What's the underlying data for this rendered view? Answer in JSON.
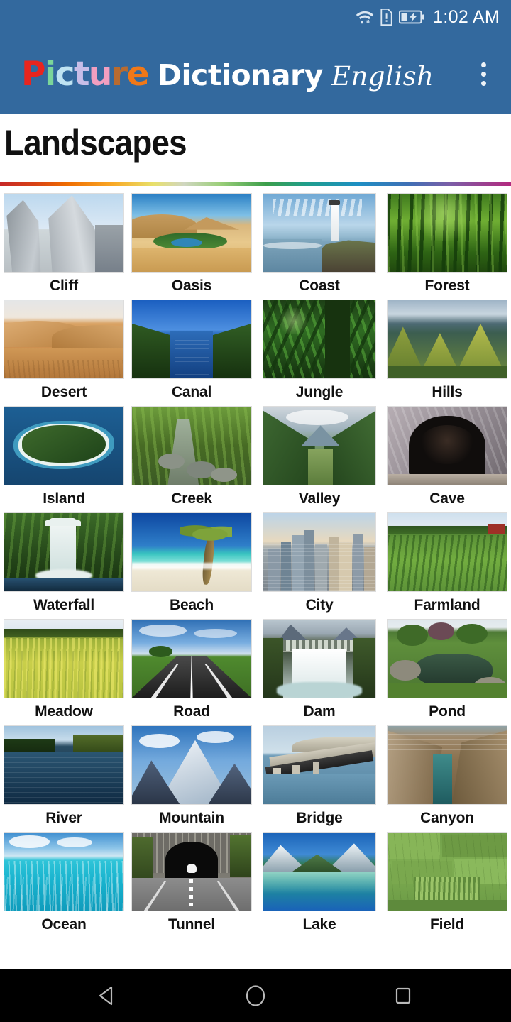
{
  "status_bar": {
    "time": "1:02 AM",
    "icons": [
      "wifi-icon",
      "sim-alert-icon",
      "battery-charging-icon"
    ]
  },
  "app_bar": {
    "background_color": "#33699E",
    "logo": {
      "word1": "Picture",
      "word1_letters": [
        {
          "char": "P",
          "color": "#E8251F"
        },
        {
          "char": "i",
          "color": "#7BD69A"
        },
        {
          "char": "c",
          "color": "#BFE3F2"
        },
        {
          "char": "t",
          "color": "#C8BEE8"
        },
        {
          "char": "u",
          "color": "#F29FC0"
        },
        {
          "char": "r",
          "color": "#B86B30"
        },
        {
          "char": "e",
          "color": "#F07818"
        }
      ],
      "word2": "Dictionary",
      "word3": "English"
    },
    "overflow_menu": "more-options"
  },
  "page": {
    "title": "Landscapes",
    "divider": "rainbow-rule"
  },
  "grid": {
    "columns": 4,
    "items": [
      {
        "label": "Cliff",
        "scene": "cliff"
      },
      {
        "label": "Oasis",
        "scene": "oasis"
      },
      {
        "label": "Coast",
        "scene": "coast"
      },
      {
        "label": "Forest",
        "scene": "forest"
      },
      {
        "label": "Desert",
        "scene": "desert"
      },
      {
        "label": "Canal",
        "scene": "canal"
      },
      {
        "label": "Jungle",
        "scene": "jungle"
      },
      {
        "label": "Hills",
        "scene": "hills"
      },
      {
        "label": "Island",
        "scene": "island"
      },
      {
        "label": "Creek",
        "scene": "creek"
      },
      {
        "label": "Valley",
        "scene": "valley"
      },
      {
        "label": "Cave",
        "scene": "cave"
      },
      {
        "label": "Waterfall",
        "scene": "waterfall"
      },
      {
        "label": "Beach",
        "scene": "beach"
      },
      {
        "label": "City",
        "scene": "city"
      },
      {
        "label": "Farmland",
        "scene": "farmland"
      },
      {
        "label": "Meadow",
        "scene": "meadow"
      },
      {
        "label": "Road",
        "scene": "road"
      },
      {
        "label": "Dam",
        "scene": "dam"
      },
      {
        "label": "Pond",
        "scene": "pond"
      },
      {
        "label": "River",
        "scene": "river"
      },
      {
        "label": "Mountain",
        "scene": "mountain"
      },
      {
        "label": "Bridge",
        "scene": "bridge"
      },
      {
        "label": "Canyon",
        "scene": "canyon"
      },
      {
        "label": "Ocean",
        "scene": "ocean"
      },
      {
        "label": "Tunnel",
        "scene": "tunnel"
      },
      {
        "label": "Lake",
        "scene": "lake"
      },
      {
        "label": "Field",
        "scene": "field"
      }
    ]
  },
  "nav_bar": {
    "background_color": "#000000",
    "buttons": [
      {
        "name": "back-button",
        "icon": "triangle-back-icon"
      },
      {
        "name": "home-button",
        "icon": "circle-home-icon"
      },
      {
        "name": "recents-button",
        "icon": "square-recents-icon"
      }
    ]
  }
}
